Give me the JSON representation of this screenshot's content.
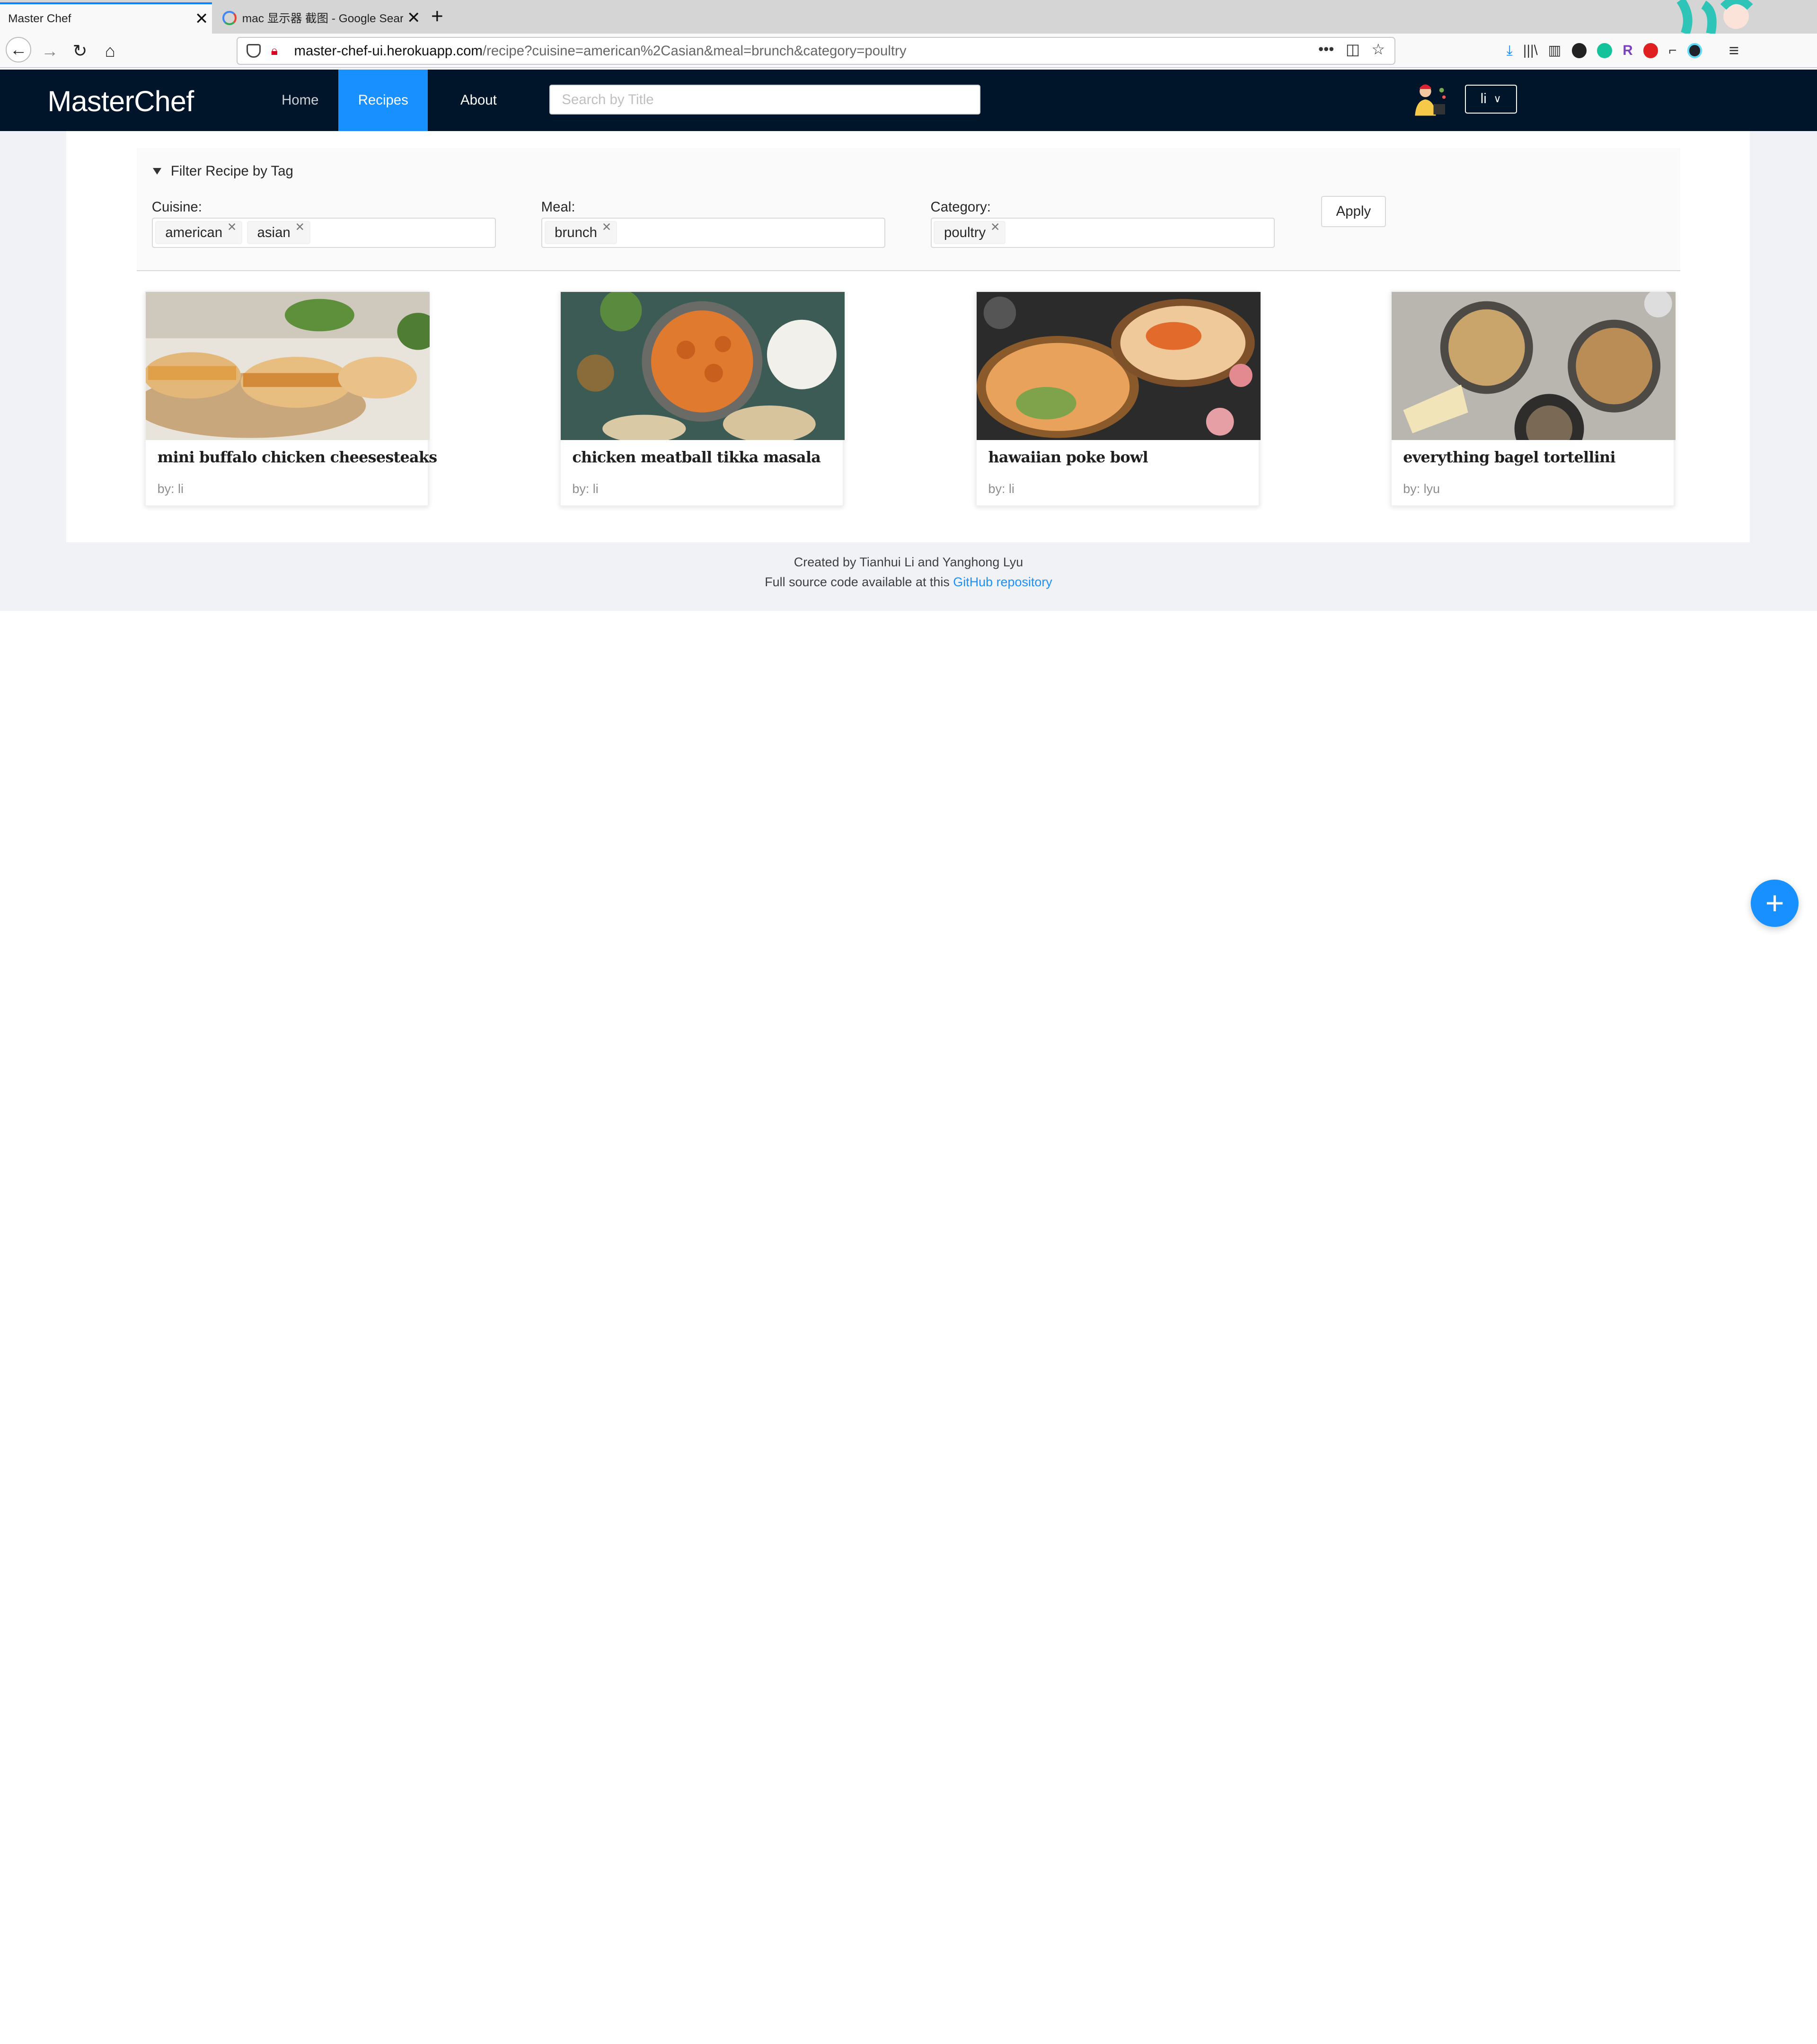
{
  "browser": {
    "tabs": [
      {
        "title": "Master Chef",
        "active": true
      },
      {
        "title": "mac 显示器 截图 - Google Search",
        "active": false
      }
    ],
    "new_tab_icon": "plus-icon",
    "url_host": "master-chef-ui.herokuapp.com",
    "url_path": "/recipe?cuisine=american%2Casian&meal=brunch&category=poultry",
    "url_actions": "•••",
    "menu_icon": "≡"
  },
  "app": {
    "brand": "MasterChef",
    "nav": [
      {
        "label": "Home",
        "selected": false
      },
      {
        "label": "Recipes",
        "selected": true
      },
      {
        "label": "About",
        "selected": false
      }
    ],
    "search_placeholder": "Search by Title",
    "user_menu_label": "li"
  },
  "filter": {
    "header": "Filter Recipe by Tag",
    "cuisine_label": "Cuisine:",
    "cuisine_tags": [
      "american",
      "asian"
    ],
    "meal_label": "Meal:",
    "meal_tags": [
      "brunch"
    ],
    "category_label": "Category:",
    "category_tags": [
      "poultry"
    ],
    "apply_label": "Apply"
  },
  "recipes": [
    {
      "title": "mini buffalo chicken cheesesteaks",
      "author": "by: li"
    },
    {
      "title": "chicken meatball tikka masala",
      "author": "by: li"
    },
    {
      "title": "hawaiian poke bowl",
      "author": "by: li"
    },
    {
      "title": "everything bagel tortellini",
      "author": "by: lyu"
    }
  ],
  "footer": {
    "line1": "Created by Tianhui Li and Yanghong Lyu",
    "line2_prefix": "Full source code available at this",
    "link_text": "GitHub repository"
  },
  "fab_icon": "+",
  "colors": {
    "header_bg": "#001529",
    "accent": "#1890ff",
    "page_bg": "#f0f2f5"
  }
}
